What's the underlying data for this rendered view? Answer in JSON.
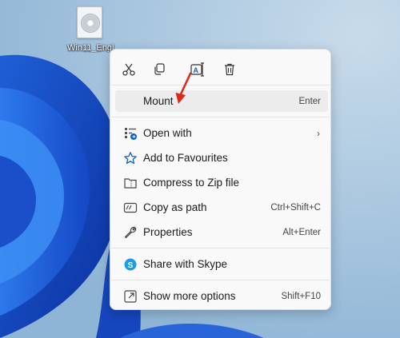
{
  "desktop": {
    "file_label": "Win11_Engl"
  },
  "menu": {
    "quick_actions": [
      {
        "icon": "scissors-icon",
        "action": "Cut"
      },
      {
        "icon": "copy-icon",
        "action": "Copy"
      },
      {
        "icon": "rename-icon",
        "action": "Rename"
      },
      {
        "icon": "trash-icon",
        "action": "Delete"
      }
    ],
    "items": [
      {
        "label": "Mount",
        "shortcut": "Enter",
        "icon": "",
        "highlighted": true
      },
      {
        "label": "Open with",
        "shortcut": "",
        "icon": "open-with-icon",
        "has_submenu": true
      },
      {
        "label": "Add to Favourites",
        "shortcut": "",
        "icon": "star-icon"
      },
      {
        "label": "Compress to Zip file",
        "shortcut": "",
        "icon": "zip-icon"
      },
      {
        "label": "Copy as path",
        "shortcut": "Ctrl+Shift+C",
        "icon": "copy-path-icon"
      },
      {
        "label": "Properties",
        "shortcut": "Alt+Enter",
        "icon": "wrench-icon"
      },
      {
        "label": "Share with Skype",
        "shortcut": "",
        "icon": "skype-icon"
      },
      {
        "label": "Show more options",
        "shortcut": "Shift+F10",
        "icon": "external-icon"
      }
    ]
  },
  "colors": {
    "menu_bg": "#f9f9f9",
    "highlight": "#ececec",
    "arrow": "#e0271b",
    "accent": "#0a64c8",
    "wallpaper": "#9fc1dc"
  }
}
